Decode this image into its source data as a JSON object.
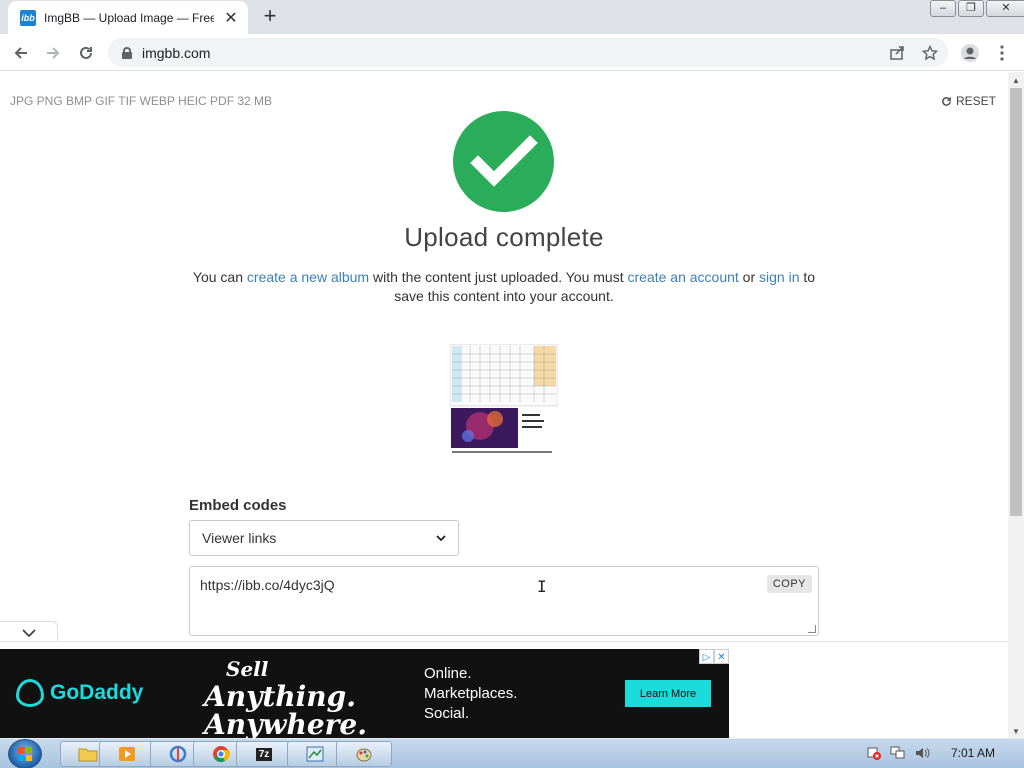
{
  "browser": {
    "tab_title": "ImgBB — Upload Image — Free",
    "favicon_text": "ibb",
    "url": "imgbb.com"
  },
  "page": {
    "formats": "JPG PNG BMP GIF TIF WEBP HEIC PDF   32 MB",
    "reset_label": "RESET",
    "heading": "Upload complete",
    "desc_prefix": "You can ",
    "link_album": "create a new album",
    "desc_mid": " with the content just uploaded. You must ",
    "link_account": "create an account",
    "desc_or": " or ",
    "link_signin": "sign in",
    "desc_suffix": " to save this content into your account.",
    "embed_label": "Embed codes",
    "embed_select_value": "Viewer links",
    "embed_code": "https://ibb.co/4dyc3jQ",
    "copy_label": "COPY"
  },
  "ad": {
    "brand": "GoDaddy",
    "slogan_1": "Sell",
    "slogan_2": "Anything.",
    "slogan_3": "Anywhere.",
    "line_1": "Online.",
    "line_2": "Marketplaces.",
    "line_3": "Social.",
    "cta": "Learn More"
  },
  "taskbar": {
    "clock": "7:01 AM",
    "app_7z": "7z"
  },
  "colors": {
    "success_green": "#2aac5a",
    "link_blue": "#3d80b8",
    "godaddy_teal": "#1bdbdb"
  }
}
